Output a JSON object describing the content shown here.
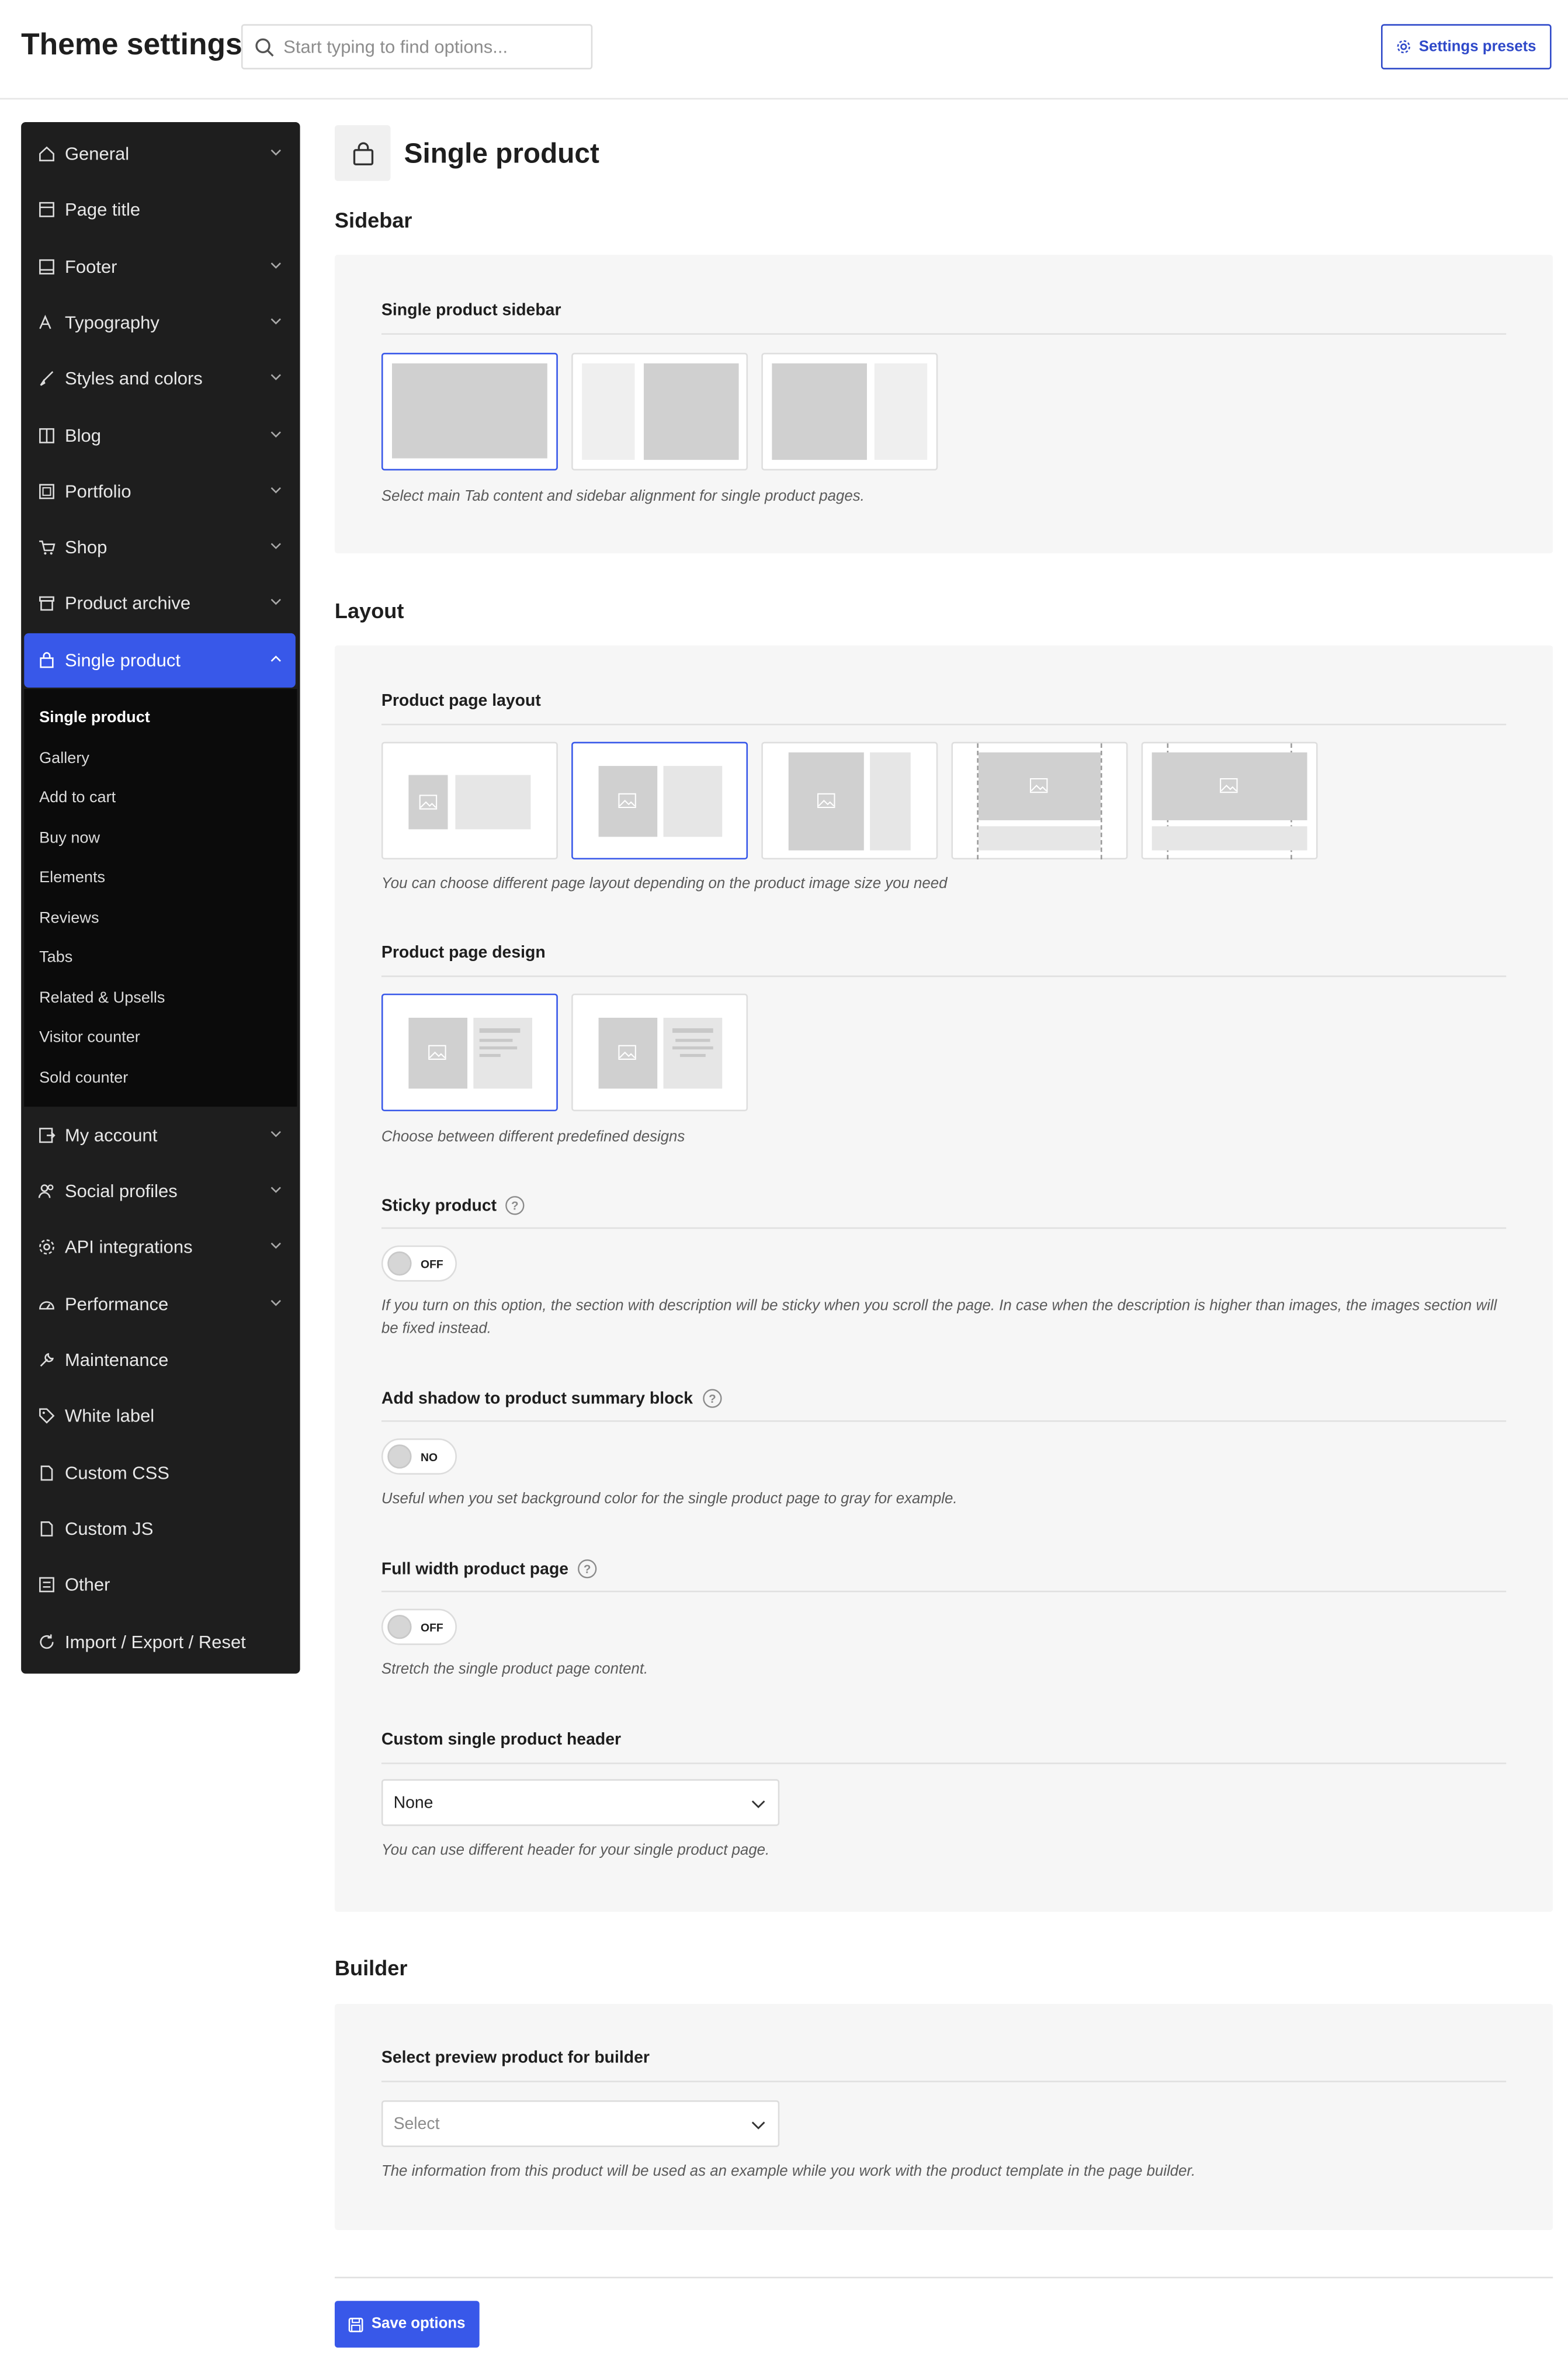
{
  "header": {
    "title": "Theme settings",
    "search_placeholder": "Start typing to find options...",
    "presets_label": "Settings presets"
  },
  "sidebar": {
    "items": [
      {
        "label": "General",
        "icon": "home-icon",
        "chevron": true
      },
      {
        "label": "Page title",
        "icon": "page-title-icon",
        "chevron": false
      },
      {
        "label": "Footer",
        "icon": "footer-icon",
        "chevron": true
      },
      {
        "label": "Typography",
        "icon": "typography-icon",
        "chevron": true
      },
      {
        "label": "Styles and colors",
        "icon": "brush-icon",
        "chevron": true
      },
      {
        "label": "Blog",
        "icon": "blog-icon",
        "chevron": true
      },
      {
        "label": "Portfolio",
        "icon": "portfolio-icon",
        "chevron": true
      },
      {
        "label": "Shop",
        "icon": "cart-icon",
        "chevron": true
      },
      {
        "label": "Product archive",
        "icon": "archive-icon",
        "chevron": true
      },
      {
        "label": "Single product",
        "icon": "bag-icon",
        "chevron": true,
        "active": true
      },
      {
        "label": "My account",
        "icon": "account-icon",
        "chevron": true
      },
      {
        "label": "Social profiles",
        "icon": "users-icon",
        "chevron": true
      },
      {
        "label": "API integrations",
        "icon": "gear-icon",
        "chevron": true
      },
      {
        "label": "Performance",
        "icon": "gauge-icon",
        "chevron": true
      },
      {
        "label": "Maintenance",
        "icon": "wrench-icon",
        "chevron": false
      },
      {
        "label": "White label",
        "icon": "tag-icon",
        "chevron": false
      },
      {
        "label": "Custom CSS",
        "icon": "css-file-icon",
        "chevron": false
      },
      {
        "label": "Custom JS",
        "icon": "js-file-icon",
        "chevron": false
      },
      {
        "label": "Other",
        "icon": "other-icon",
        "chevron": false
      },
      {
        "label": "Import / Export / Reset",
        "icon": "reset-icon",
        "chevron": false
      }
    ],
    "submenu": [
      "Single product",
      "Gallery",
      "Add to cart",
      "Buy now",
      "Elements",
      "Reviews",
      "Tabs",
      "Related & Upsells",
      "Visitor counter",
      "Sold counter"
    ]
  },
  "page": {
    "title": "Single product",
    "icon": "shopping-bag-icon"
  },
  "sections": {
    "sidebar": {
      "title": "Sidebar",
      "option_label": "Single product sidebar",
      "help": "Select main Tab content and sidebar alignment for single product pages.",
      "selected_index": 0
    },
    "layout": {
      "title": "Layout",
      "page_layout": {
        "label": "Product page layout",
        "help": "You can choose different page layout depending on the product image size you need",
        "selected_index": 1
      },
      "page_design": {
        "label": "Product page design",
        "help": "Choose between different predefined designs",
        "selected_index": 0
      },
      "sticky": {
        "label": "Sticky product",
        "toggle": "OFF",
        "help": "If you turn on this option, the section with description will be sticky when you scroll the page. In case when the description is higher than images, the images section will be fixed instead."
      },
      "shadow": {
        "label": "Add shadow to product summary block",
        "toggle": "NO",
        "help": "Useful when you set background color for the single product page to gray for example."
      },
      "full_width": {
        "label": "Full width product page",
        "toggle": "OFF",
        "help": "Stretch the single product page content."
      },
      "custom_header": {
        "label": "Custom single product header",
        "value": "None",
        "help": "You can use different header for your single product page."
      }
    },
    "builder": {
      "title": "Builder",
      "label": "Select preview product for builder",
      "placeholder": "Select",
      "help": "The information from this product will be used as an example while you work with the product template in the page builder."
    }
  },
  "footer": {
    "save_label": "Save options"
  },
  "colors": {
    "accent": "#3858e9",
    "sidebar_bg": "#1e1e1e",
    "submenu_bg": "#0b0b0b",
    "panel_bg": "#f6f6f6",
    "placeholder_gray": "#d0d0d0"
  }
}
